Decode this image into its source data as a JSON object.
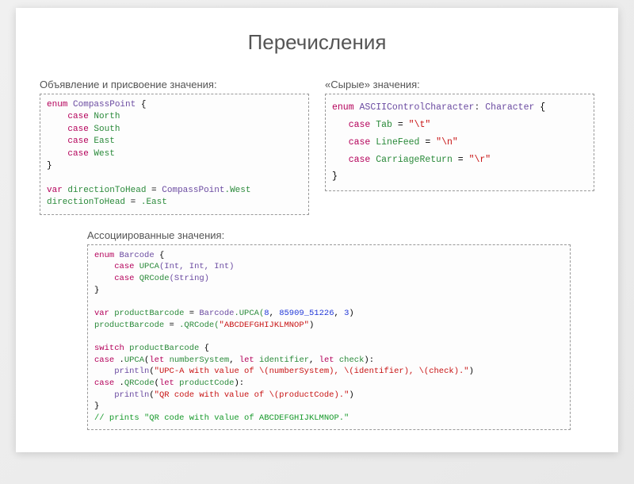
{
  "title": "Перечисления",
  "section1": {
    "label": "Объявление и присвоение значения:",
    "code": {
      "enum_kw": "enum",
      "enum_name": "CompassPoint",
      "case_kw": "case",
      "c1": "North",
      "c2": "South",
      "c3": "East",
      "c4": "West",
      "var_kw": "var",
      "var_name": "directionToHead",
      "assign1": "CompassPoint",
      "assign1_dot": ".West",
      "line2_lhs": "directionToHead",
      "line2_rhs": ".East"
    }
  },
  "section2": {
    "label": "«Сырые» значения:",
    "code": {
      "enum_kw": "enum",
      "enum_name": "ASCIIControlCharacter",
      "colon": ":",
      "raw_type": "Character",
      "case_kw": "case",
      "c1": "Tab",
      "v1": "\"\\t\"",
      "c2": "LineFeed",
      "v2": "\"\\n\"",
      "c3": "CarriageReturn",
      "v3": "\"\\r\""
    }
  },
  "section3": {
    "label": "Ассоциированные значения:",
    "code": {
      "enum_kw": "enum",
      "enum_name": "Barcode",
      "case_kw": "case",
      "case1": "UPCA",
      "case1_sig": "(Int, Int, Int)",
      "case2": "QRCode",
      "case2_sig": "(String)",
      "var_kw": "var",
      "var_name": "productBarcode",
      "assign_type": "Barcode",
      "assign_call": ".UPCA(",
      "n1": "8",
      "n2": "85909_51226",
      "n3": "3",
      "line2_lhs": "productBarcode",
      "line2_rhs_call": ".QRCode(",
      "qr_str": "\"ABCDEFGHIJKLMNOP\"",
      "switch_kw": "switch",
      "switch_subj": "productBarcode",
      "let_kw": "let",
      "bind1": "numberSystem",
      "bind2": "identifier",
      "bind3": "check",
      "println": "println",
      "pstr1": "\"UPC-A with value of \\(numberSystem), \\(identifier), \\(check).\"",
      "bind_q": "productCode",
      "pstr2": "\"QR code with value of \\(productCode).\"",
      "comment": "// prints \"QR code with value of ABCDEFGHIJKLMNOP.\""
    }
  }
}
